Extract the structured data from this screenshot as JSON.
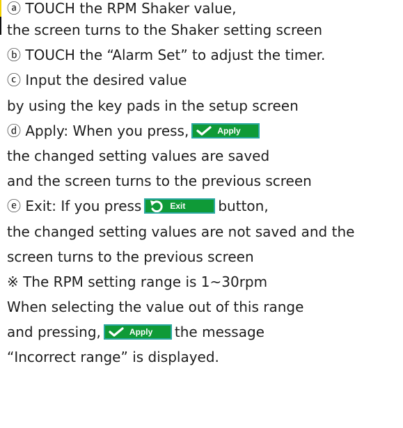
{
  "lines": [
    "ⓐ TOUCH the RPM Shaker value,",
    "the screen turns to the Shaker setting screen",
    "ⓑ TOUCH the “Alarm Set” to adjust the timer.",
    "ⓒ Input the desired value",
    "by using the key pads in the setup screen",
    "ⓓ Apply: When you press,",
    "the changed setting values are saved",
    "and the screen turns to the previous screen",
    "ⓔ Exit: If you press",
    "button,",
    "the changed setting values are not saved and the",
    "screen turns to the previous screen",
    "※ The RPM setting range is 1~30rpm",
    "When selecting the value out of this range",
    "and pressing,",
    "the message",
    "“Incorrect range” is displayed."
  ],
  "buttons": {
    "apply_label": "Apply",
    "exit_label": "Exit",
    "apply_icon": "checkmark-icon",
    "exit_icon": "undo-arrow-icon"
  },
  "colors": {
    "text": "#1c1c1c",
    "button_fill": "#0f9a37",
    "button_border": "#2aa7a0",
    "button_text": "#ffffff",
    "accent_bar": "#f2d000"
  }
}
